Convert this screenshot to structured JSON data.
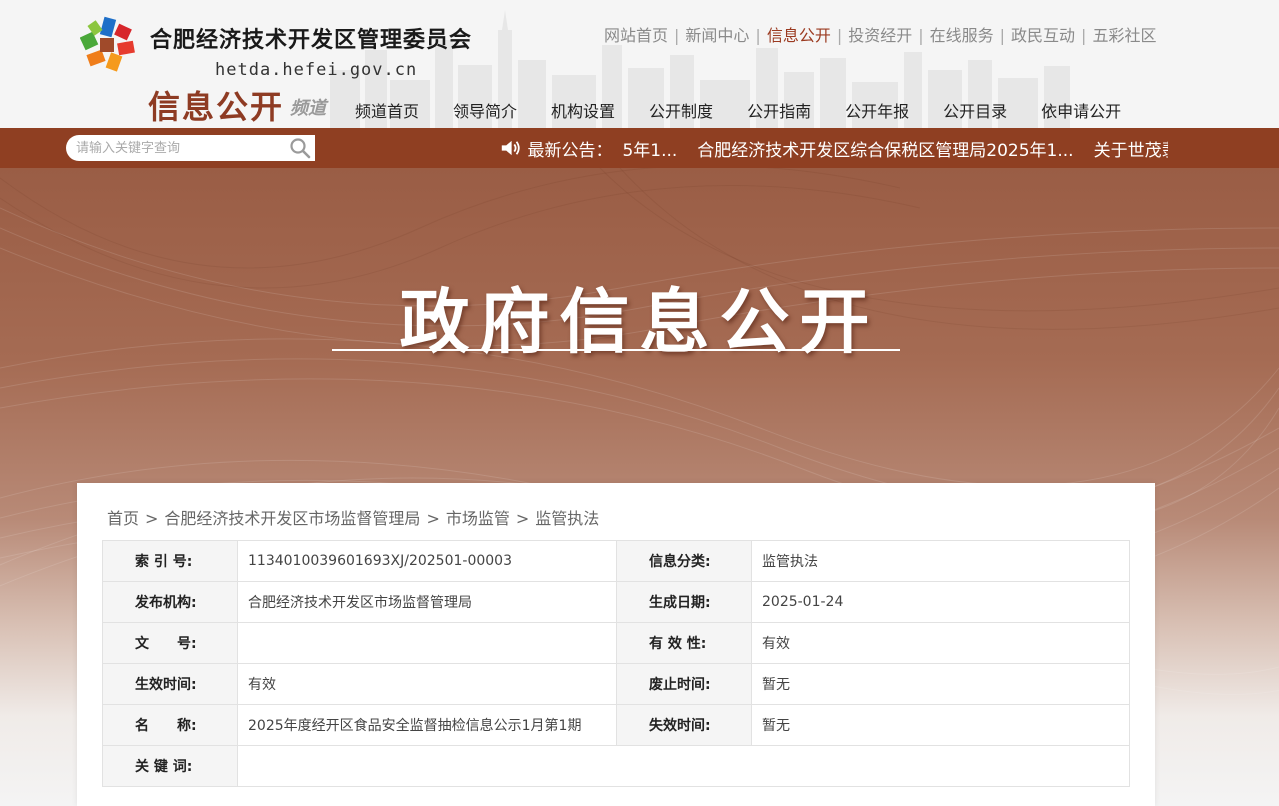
{
  "header": {
    "site_title": "合肥经济技术开发区管理委员会",
    "domain": "hetda.hefei.gov.cn",
    "channel_title": "信息公开",
    "channel_sub": "频道",
    "top_links": [
      "网站首页",
      "新闻中心",
      "信息公开",
      "投资经开",
      "在线服务",
      "政民互动",
      "五彩社区"
    ],
    "active_top_link": "信息公开",
    "nav": [
      "频道首页",
      "领导简介",
      "机构设置",
      "公开制度",
      "公开指南",
      "公开年报",
      "公开目录",
      "依申请公开"
    ]
  },
  "search": {
    "placeholder": "请输入关键字查询"
  },
  "announcement": {
    "label": "最新公告：",
    "items": [
      "5年1...",
      "合肥经济技术开发区综合保税区管理局2025年1...",
      "关于世茂翡翠府"
    ]
  },
  "banner": {
    "title": "政府信息公开"
  },
  "breadcrumb": [
    "首页",
    "合肥经济技术开发区市场监督管理局",
    "市场监管",
    "监管执法"
  ],
  "meta_table": {
    "rows": [
      {
        "k1": "索 引 号:",
        "v1": "1134010039601693XJ/202501-00003",
        "k2": "信息分类:",
        "v2": "监管执法"
      },
      {
        "k1": "发布机构:",
        "v1": "合肥经济技术开发区市场监督管理局",
        "k2": "生成日期:",
        "v2": "2025-01-24"
      },
      {
        "k1": "文　　号:",
        "v1": "",
        "k2": "有 效 性:",
        "v2": "有效"
      },
      {
        "k1": "生效时间:",
        "v1": "有效",
        "k2": "废止时间:",
        "v2": "暂无"
      },
      {
        "k1": "名　　称:",
        "v1": "2025年度经开区食品安全监督抽检信息公示1月第1期",
        "k2": "失效时间:",
        "v2": "暂无"
      },
      {
        "k1": "关 键 词:",
        "v1": ""
      }
    ]
  },
  "colors": {
    "brand": "#8f3f22",
    "active_link": "#9b3a20",
    "channel_title": "#8e3b23"
  }
}
